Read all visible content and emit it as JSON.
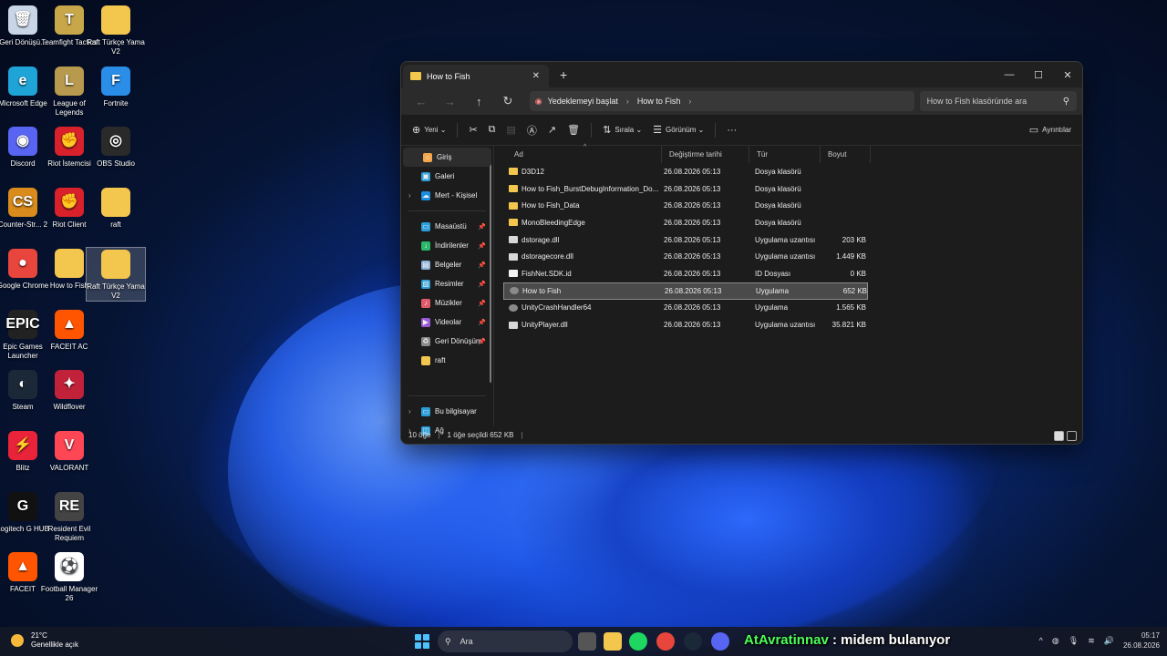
{
  "desktop": {
    "icons": [
      {
        "label": "Geri Dönüşü...",
        "glyph": "🗑",
        "color": "#c9d6e8"
      },
      {
        "label": "Teamfight Tactics",
        "glyph": "T",
        "color": "#c8a64a"
      },
      {
        "label": "Raft Türkçe Yama V2",
        "glyph": "",
        "color": "#f3c64d"
      },
      {
        "label": "Microsoft Edge",
        "glyph": "e",
        "color": "#1fa4d8"
      },
      {
        "label": "League of Legends",
        "glyph": "L",
        "color": "#b89a4e"
      },
      {
        "label": "Fortnite",
        "glyph": "F",
        "color": "#2a8ee8"
      },
      {
        "label": "Discord",
        "glyph": "◉",
        "color": "#5865f2"
      },
      {
        "label": "Riot İstemcisi",
        "glyph": "✊",
        "color": "#d8212b"
      },
      {
        "label": "OBS Studio",
        "glyph": "◎",
        "color": "#2a2a2a"
      },
      {
        "label": "Counter-Str... 2",
        "glyph": "CS",
        "color": "#d98b1c"
      },
      {
        "label": "Riot Client",
        "glyph": "✊",
        "color": "#d8212b"
      },
      {
        "label": "raft",
        "glyph": "",
        "color": "#f3c64d"
      },
      {
        "label": "Google Chrome",
        "glyph": "●",
        "color": "#e8453c"
      },
      {
        "label": "How to Fish",
        "glyph": "",
        "color": "#f3c64d"
      },
      {
        "label": "Raft Türkçe Yama V2",
        "glyph": "",
        "color": "#f3c64d"
      },
      {
        "label": "Epic Games Launcher",
        "glyph": "EPIC",
        "color": "#222"
      },
      {
        "label": "FACEIT AC",
        "glyph": "▲",
        "color": "#ff5500"
      },
      {
        "label": "Steam",
        "glyph": "◐",
        "color": "#1b2838"
      },
      {
        "label": "Wildflover",
        "glyph": "✦",
        "color": "#c2213a"
      },
      {
        "label": "Blitz",
        "glyph": "⚡",
        "color": "#e8233a"
      },
      {
        "label": "VALORANT",
        "glyph": "V",
        "color": "#ff4655"
      },
      {
        "label": "Logitech G HUB",
        "glyph": "G",
        "color": "#111"
      },
      {
        "label": "Resident Evil Requiem",
        "glyph": "RE",
        "color": "#444"
      },
      {
        "label": "FACEIT",
        "glyph": "▲",
        "color": "#ff5500"
      },
      {
        "label": "Football Manager 26",
        "glyph": "⚽",
        "color": "#fff"
      }
    ]
  },
  "explorer": {
    "tab_title": "How to Fish",
    "tab_close": "✕",
    "new_tab": "+",
    "controls": {
      "minimize": "—",
      "maximize": "☐",
      "close": "✕"
    },
    "nav": {
      "back": "←",
      "forward": "→",
      "up": "↑",
      "refresh": "↻"
    },
    "address": {
      "root": "Yedeklemeyi başlat",
      "current": "How to Fish",
      "sep": "›"
    },
    "search_placeholder": "How to Fish klasöründe ara",
    "toolbar": {
      "new": "Yeni",
      "sort": "Sırala",
      "view": "Görünüm",
      "more": "···",
      "details": "Ayrıntılar"
    },
    "sidebar": [
      {
        "label": "Giriş",
        "icon": "⌂",
        "color": "#f3a64a",
        "pin": ""
      },
      {
        "label": "Galeri",
        "icon": "▣",
        "color": "#2a9dd8",
        "pin": ""
      },
      {
        "label": "Mert - Kişisel",
        "icon": "☁",
        "color": "#1a8fe0",
        "pin": ""
      },
      {
        "label": "Masaüstü",
        "icon": "▭",
        "color": "#2a9dd8",
        "pin": "📌"
      },
      {
        "label": "İndirilenler",
        "icon": "↓",
        "color": "#2ab86a",
        "pin": "📌"
      },
      {
        "label": "Belgeler",
        "icon": "▤",
        "color": "#8ab0d8",
        "pin": "📌"
      },
      {
        "label": "Resimler",
        "icon": "▨",
        "color": "#2a9dd8",
        "pin": "📌"
      },
      {
        "label": "Müzikler",
        "icon": "♪",
        "color": "#e05a6a",
        "pin": "📌"
      },
      {
        "label": "Videolar",
        "icon": "▶",
        "color": "#9a5ad8",
        "pin": "📌"
      },
      {
        "label": "Geri Dönüşüm",
        "icon": "♻",
        "color": "#8a8a8a",
        "pin": "📌"
      },
      {
        "label": "raft",
        "icon": "",
        "color": "#f3c64d",
        "pin": ""
      },
      {
        "label": "Bu bilgisayar",
        "icon": "▭",
        "color": "#2a9dd8",
        "pin": ""
      },
      {
        "label": "Ağ",
        "icon": "◫",
        "color": "#2a9dd8",
        "pin": ""
      }
    ],
    "columns": {
      "name": "Ad",
      "date": "Değiştirme tarihi",
      "type": "Tür",
      "size": "Boyut"
    },
    "files": [
      {
        "name": "D3D12",
        "date": "26.08.2026 05:13",
        "type": "Dosya klasörü",
        "size": "",
        "kind": "folder"
      },
      {
        "name": "How to Fish_BurstDebugInformation_Do...",
        "date": "26.08.2026 05:13",
        "type": "Dosya klasörü",
        "size": "",
        "kind": "folder"
      },
      {
        "name": "How to Fish_Data",
        "date": "26.08.2026 05:13",
        "type": "Dosya klasörü",
        "size": "",
        "kind": "folder"
      },
      {
        "name": "MonoBleedingEdge",
        "date": "26.08.2026 05:13",
        "type": "Dosya klasörü",
        "size": "",
        "kind": "folder"
      },
      {
        "name": "dstorage.dll",
        "date": "26.08.2026 05:13",
        "type": "Uygulama uzantısı",
        "size": "203 KB",
        "kind": "dll"
      },
      {
        "name": "dstoragecore.dll",
        "date": "26.08.2026 05:13",
        "type": "Uygulama uzantısı",
        "size": "1.449 KB",
        "kind": "dll"
      },
      {
        "name": "FishNet.SDK.id",
        "date": "26.08.2026 05:13",
        "type": "ID Dosyası",
        "size": "0 KB",
        "kind": "file"
      },
      {
        "name": "How to Fish",
        "date": "26.08.2026 05:13",
        "type": "Uygulama",
        "size": "652 KB",
        "kind": "app",
        "selected": true
      },
      {
        "name": "UnityCrashHandler64",
        "date": "26.08.2026 05:13",
        "type": "Uygulama",
        "size": "1.565 KB",
        "kind": "app"
      },
      {
        "name": "UnityPlayer.dll",
        "date": "26.08.2026 05:13",
        "type": "Uygulama uzantısı",
        "size": "35.821 KB",
        "kind": "dll"
      }
    ],
    "status": {
      "count": "10 öğe",
      "selected": "1 öğe seçildi  652 KB",
      "bar": "|"
    }
  },
  "taskbar": {
    "weather": {
      "temp": "21°C",
      "desc": "Genellikle açık"
    },
    "search_label": "Ara",
    "overlay": {
      "user": "AtAvratinnav",
      "message": " : midem bulanıyor"
    },
    "clock": {
      "time": "05:17",
      "date": "26.08.2026"
    }
  }
}
